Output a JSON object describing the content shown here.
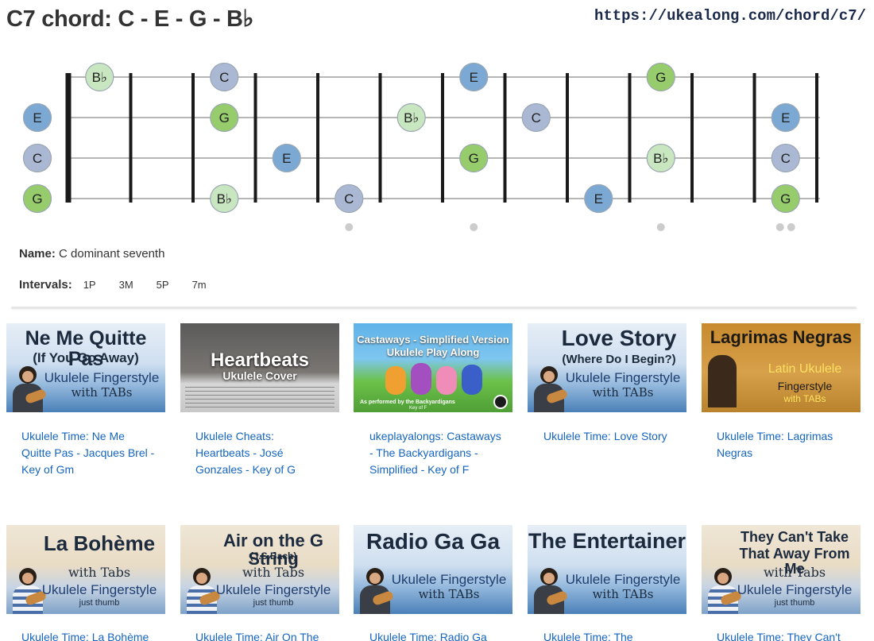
{
  "page": {
    "title": "C7 chord: C - E - G - B♭",
    "url": "https://ukealong.com/chord/c7/"
  },
  "chord": {
    "name_label": "Name:",
    "name": "C dominant seventh",
    "intervals_label": "Intervals:",
    "intervals": [
      "1P",
      "3M",
      "5P",
      "7m"
    ]
  },
  "fretboard": {
    "frets_shown": 12,
    "open_strings": [
      "E",
      "C",
      "G"
    ],
    "notes": [
      {
        "string": 1,
        "fret": 1,
        "note": "B♭"
      },
      {
        "string": 1,
        "fret": 3,
        "note": "C"
      },
      {
        "string": 1,
        "fret": 7,
        "note": "E"
      },
      {
        "string": 1,
        "fret": 10,
        "note": "G"
      },
      {
        "string": 2,
        "fret": 0,
        "note": "E"
      },
      {
        "string": 2,
        "fret": 3,
        "note": "G"
      },
      {
        "string": 2,
        "fret": 6,
        "note": "B♭"
      },
      {
        "string": 2,
        "fret": 8,
        "note": "C"
      },
      {
        "string": 2,
        "fret": 12,
        "note": "E"
      },
      {
        "string": 3,
        "fret": 0,
        "note": "C"
      },
      {
        "string": 3,
        "fret": 4,
        "note": "E"
      },
      {
        "string": 3,
        "fret": 7,
        "note": "G"
      },
      {
        "string": 3,
        "fret": 10,
        "note": "B♭"
      },
      {
        "string": 3,
        "fret": 12,
        "note": "C"
      },
      {
        "string": 4,
        "fret": 0,
        "note": "G"
      },
      {
        "string": 4,
        "fret": 3,
        "note": "B♭"
      },
      {
        "string": 4,
        "fret": 5,
        "note": "C"
      },
      {
        "string": 4,
        "fret": 9,
        "note": "E"
      },
      {
        "string": 4,
        "fret": 12,
        "note": "G"
      }
    ],
    "marker_frets": [
      5,
      7,
      10
    ],
    "double_marker_fret": 12,
    "colors": {
      "C": "#aab8d4",
      "E": "#7ba9d4",
      "G": "#96cc6c",
      "B♭": "#c8e6c0",
      "dot_border": "#9aa6b2",
      "marker": "#cccccc"
    }
  },
  "videos": [
    {
      "caption": "Ukulele Time: Ne Me Quitte Pas - Jacques Brel - Key of Gm",
      "thumb_lines": [
        "Ne Me Quitte Pas",
        "(If You Go Away)",
        "Ukulele Fingerstyle",
        "with TABs"
      ]
    },
    {
      "caption": "Ukulele Cheats: Heartbeats - José Gonzales - Key of G",
      "thumb_lines": [
        "Heartbeats",
        "Ukulele Cover"
      ]
    },
    {
      "caption": "ukeplayalongs: Castaways - The Backyardigans - Simplified - Key of F",
      "thumb_lines": [
        "Castaways - Simplified Version",
        "Ukulele Play Along",
        "As performed by the Backyardigans",
        "Key of F"
      ]
    },
    {
      "caption": "Ukulele Time: Love Story",
      "thumb_lines": [
        "Love Story",
        "(Where Do I Begin?)",
        "Ukulele Fingerstyle",
        "with TABs"
      ]
    },
    {
      "caption": "Ukulele Time: Lagrimas Negras",
      "thumb_lines": [
        "Lagrimas Negras",
        "Latin Ukulele",
        "Fingerstyle",
        "with TABs"
      ]
    },
    {
      "caption": "Ukulele Time: La Bohème",
      "thumb_lines": [
        "La Bohème",
        "with Tabs",
        "Ukulele Fingerstyle",
        "just thumb"
      ]
    },
    {
      "caption": "Ukulele Time: Air On The",
      "thumb_lines": [
        "Air on the G String",
        "(J.S.Bach)",
        "with Tabs",
        "Ukulele Fingerstyle",
        "just thumb"
      ]
    },
    {
      "caption": "Ukulele Time: Radio Ga",
      "thumb_lines": [
        "Radio Ga Ga",
        "Ukulele Fingerstyle",
        "with TABs"
      ]
    },
    {
      "caption": "Ukulele Time: The",
      "thumb_lines": [
        "The Entertainer",
        "Ukulele Fingerstyle",
        "with TABs"
      ]
    },
    {
      "caption": "Ukulele Time: They Can't",
      "thumb_lines": [
        "They Can't Take",
        "That Away From Me",
        "with Tabs",
        "Ukulele Fingerstyle",
        "just thumb"
      ]
    }
  ]
}
